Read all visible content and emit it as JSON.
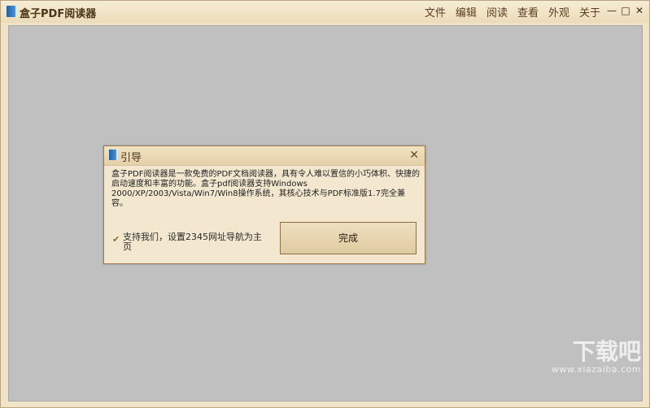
{
  "window": {
    "title": "盒子PDF阅读器",
    "menu": [
      "文件",
      "编辑",
      "阅读",
      "查看",
      "外观",
      "关于"
    ],
    "controls": {
      "minimize": "—",
      "maximize": "□",
      "close": "✕"
    }
  },
  "dialog": {
    "title": "引导",
    "close_glyph": "✕",
    "body": "盒子PDF阅读器是一款免费的PDF文档阅读器，具有令人难以置信的小巧体积、快捷的启动速度和丰富的功能。盒子pdf阅读器支持Windows 2000/XP/2003/Vista/Win7/Win8操作系统，其核心技术与PDF标准版1.7完全兼容。",
    "support_label": "支持我们，设置2345网址导航为主页",
    "done_button": "完成"
  },
  "watermark": {
    "main": "下载吧",
    "sub": "www.xiazaiba.com"
  },
  "icons": {
    "app_icon": "book-icon",
    "dialog_icon": "book-icon",
    "check_icon": "check-icon"
  },
  "colors": {
    "frame": "#efe3c8",
    "workspace": "#c0c0c0",
    "dialog": "#f3e7cf",
    "border": "#9c7a4c"
  }
}
